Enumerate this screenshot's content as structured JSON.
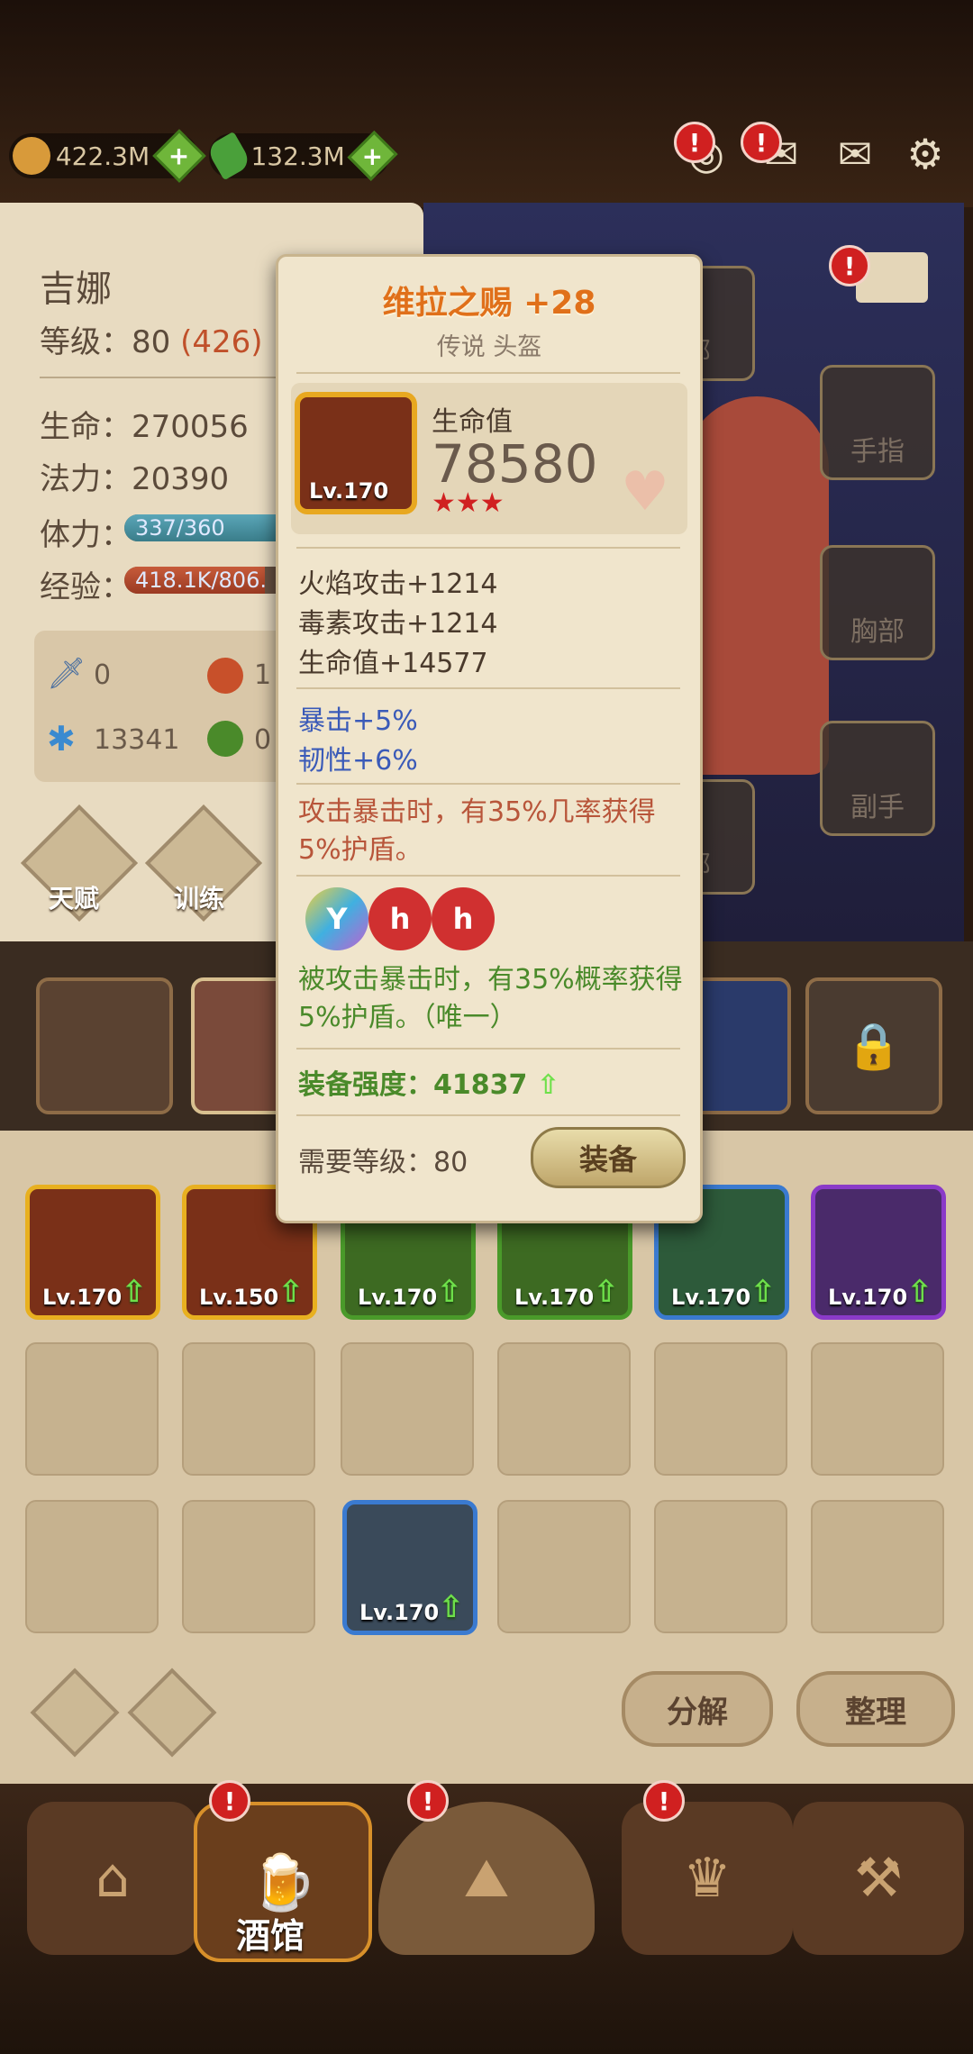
{
  "currency": {
    "gold": "422.3M",
    "gems": "132.3M"
  },
  "hero": {
    "name": "吉娜",
    "level_label": "等级：",
    "level": "80",
    "level_extra": "(426)",
    "hp_label": "生命：",
    "hp": "270056",
    "mp_label": "法力：",
    "mp": "20390",
    "stamina_label": "体力：",
    "stamina": "337/360",
    "stamina_fraction": 0.936,
    "exp_label": "经验：",
    "exp": "418.1K/806.",
    "exp_fraction": 0.52,
    "res": {
      "sword": "0",
      "fire": "1",
      "ice": "13341",
      "poison": "0"
    },
    "btn_talent": "天赋",
    "btn_train": "训练"
  },
  "slots": {
    "slot_a": "部",
    "ring": "手指",
    "chest": "胸部",
    "offhand": "副手",
    "slot_b": "部"
  },
  "bag": {
    "items": [
      {
        "level": "Lv.170",
        "border": "#e8b020",
        "bg": "#7a3018"
      },
      {
        "level": "Lv.150",
        "border": "#e8b020",
        "bg": "#7a3018"
      },
      {
        "level": "Lv.170",
        "border": "#4a9a2a",
        "bg": "#3d6a22"
      },
      {
        "level": "Lv.170",
        "border": "#4a9a2a",
        "bg": "#3d6a22"
      },
      {
        "level": "Lv.170",
        "border": "#3a7ad0",
        "bg": "#2d5a3a"
      },
      {
        "level": "Lv.170",
        "border": "#8a3ac8",
        "bg": "#4a2a6a"
      }
    ],
    "gloves_level": "Lv.170",
    "btn_decompose": "分解",
    "btn_sort": "整理"
  },
  "nav": {
    "tavern": "酒馆"
  },
  "tooltip": {
    "title": "维拉之赐 +28",
    "subtitle": "传说 头盔",
    "item_level": "Lv.170",
    "stat_name": "生命值",
    "stat_value": "78580",
    "stars": "★★★",
    "attrs": [
      "火焰攻击+1214",
      "毒素攻击+1214",
      "生命值+14577"
    ],
    "bonus": [
      "暴击+5%",
      "韧性+6%"
    ],
    "special": "攻击暴击时，有35%几率获得5%护盾。",
    "set_effect": "被攻击暴击时，有35%概率获得5%护盾。（唯一）",
    "power_label": "装备强度：",
    "power": "41837",
    "req_label": "需要等级：",
    "req_level": "80",
    "equip_button": "装备"
  }
}
